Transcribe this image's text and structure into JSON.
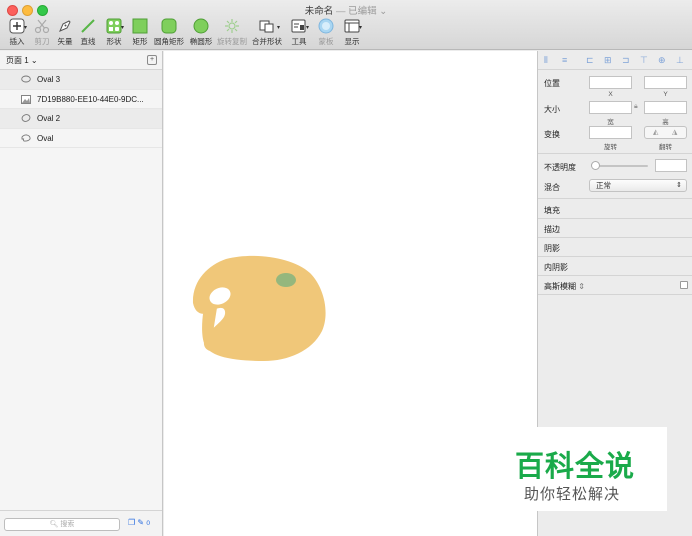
{
  "window": {
    "title": "未命名",
    "separator": "—",
    "status": "已编辑"
  },
  "toolbar": {
    "insert": "插入",
    "scissors": "剪刀",
    "vector": "矢量",
    "line": "直线",
    "shape": "形状",
    "rectangle": "矩形",
    "rounded_rect": "圆角矩形",
    "oval": "椭圆形",
    "rotate_copy": "旋转复制",
    "combine_shapes": "合并形状",
    "tools": "工具",
    "mask": "蒙板",
    "display": "显示"
  },
  "layers_panel": {
    "page": "页面 1",
    "layers": [
      {
        "name": "Oval 3",
        "icon": "oval-icon"
      },
      {
        "name": "7D19B880-EE10-44E0-9DC...",
        "icon": "image-icon"
      },
      {
        "name": "Oval 2",
        "icon": "oval-icon"
      },
      {
        "name": "Oval",
        "icon": "oval-icon"
      }
    ],
    "search_placeholder": "搜索",
    "bottom_count": "0"
  },
  "inspector": {
    "position": "位置",
    "x": "X",
    "y": "Y",
    "size": "大小",
    "width": "宽",
    "height": "高",
    "transform": "变换",
    "rotate": "旋转",
    "flip": "翻转",
    "opacity": "不透明度",
    "blend": "混合",
    "blend_value": "正常",
    "fill": "填充",
    "border": "描边",
    "shadow": "阴影",
    "inner_shadow": "内阴影",
    "gaussian_blur": "高斯模糊"
  },
  "colors": {
    "palette_fill": "#f0c779",
    "palette_spot": "#95b77d",
    "accent": "#2a6de0"
  },
  "watermark": {
    "title": "百科全说",
    "subtitle": "助你轻松解决"
  }
}
